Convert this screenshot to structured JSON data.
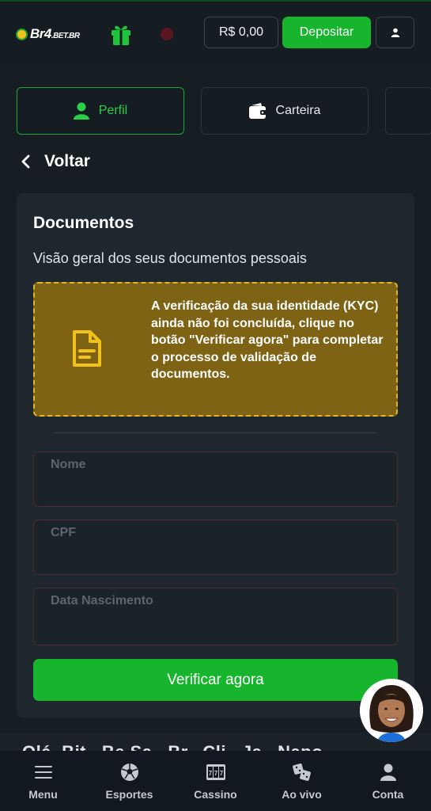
{
  "header": {
    "logo_text": "Br4",
    "logo_suffix": ".BET.BR",
    "balance": "R$ 0,00",
    "deposit_label": "Depositar"
  },
  "tabs": [
    {
      "label": "Perfil",
      "icon": "user-icon",
      "active": true
    },
    {
      "label": "Carteira",
      "icon": "wallet-icon",
      "active": false
    }
  ],
  "back": {
    "label": "Voltar"
  },
  "documents": {
    "title": "Documentos",
    "subtitle": "Visão geral dos seus documentos pessoais",
    "notice": "A verificação da sua identidade (KYC) ainda não foi concluída, clique no botão \"Verificar agora\" para completar o processo de validação de documentos.",
    "fields": [
      {
        "label": "Nome",
        "value": ""
      },
      {
        "label": "CPF",
        "value": ""
      },
      {
        "label": "Data Nascimento",
        "value": ""
      }
    ],
    "verify_label": "Verificar agora"
  },
  "partial_text": "Olá, Bit...Be Sa...Br...Cli...Ja...Napo...",
  "nav": [
    {
      "label": "Menu",
      "icon": "menu-icon"
    },
    {
      "label": "Esportes",
      "icon": "soccer-ball-icon"
    },
    {
      "label": "Cassino",
      "icon": "slot-machine-icon"
    },
    {
      "label": "Ao vivo",
      "icon": "dice-icon"
    },
    {
      "label": "Conta",
      "icon": "account-icon"
    }
  ],
  "colors": {
    "accent": "#16b52d",
    "notice_bg": "#7f6315",
    "notice_border": "#e0b52a",
    "background": "#161d23"
  }
}
